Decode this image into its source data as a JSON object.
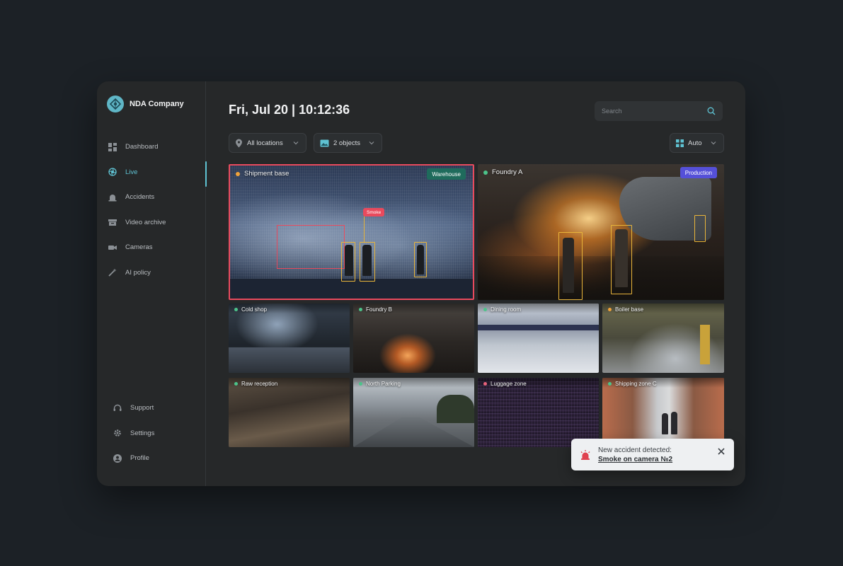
{
  "brand": {
    "name": "NDA Company"
  },
  "nav": {
    "items": [
      {
        "label": "Dashboard",
        "icon": "dashboard-icon"
      },
      {
        "label": "Live",
        "icon": "live-icon"
      },
      {
        "label": "Accidents",
        "icon": "alarm-icon"
      },
      {
        "label": "Video archive",
        "icon": "archive-icon"
      },
      {
        "label": "Cameras",
        "icon": "camera-icon"
      },
      {
        "label": "AI policy",
        "icon": "ai-policy-icon"
      }
    ],
    "active": "Live",
    "bottom": [
      {
        "label": "Support",
        "icon": "headset-icon"
      },
      {
        "label": "Settings",
        "icon": "gear-icon"
      },
      {
        "label": "Profile",
        "icon": "profile-icon"
      }
    ]
  },
  "header": {
    "datetime": "Fri, Jul 20 | 10:12:36",
    "search_placeholder": "Search"
  },
  "filters": {
    "location": "All locations",
    "objects": "2 objects",
    "layout": "Auto"
  },
  "cameras": {
    "large": [
      {
        "name": "Shipment base",
        "status": "warning",
        "tag": "Warehouse",
        "tag_color": "#1f6b5c",
        "detection": "Smoke"
      },
      {
        "name": "Foundry A",
        "status": "online",
        "tag": "Production",
        "tag_color": "#5550d8"
      }
    ],
    "small": [
      {
        "name": "Cold shop",
        "status": "online"
      },
      {
        "name": "Foundry B",
        "status": "online"
      },
      {
        "name": "Dining room",
        "status": "online"
      },
      {
        "name": "Boiler base",
        "status": "warning"
      },
      {
        "name": "Raw reception",
        "status": "online"
      },
      {
        "name": "North Parking",
        "status": "online"
      },
      {
        "name": "Luggage zone",
        "status": "offline"
      },
      {
        "name": "Shipping zone C",
        "status": "online"
      }
    ]
  },
  "status_colors": {
    "online": "#4cc38a",
    "warning": "#f0a23a",
    "offline": "#e8627a"
  },
  "accent": "#5fc3d3",
  "toast": {
    "title": "New accident detected:",
    "link": "Smoke on camera №2"
  }
}
